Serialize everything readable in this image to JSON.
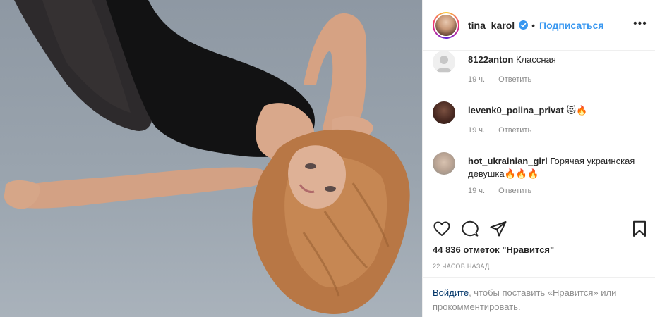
{
  "header": {
    "username": "tina_karol",
    "separator": "•",
    "follow_label": "Подписаться",
    "more_label": "•••"
  },
  "comments": [
    {
      "user": "8122anton",
      "text": "Классная",
      "time": "19 ч.",
      "reply_label": "Ответить",
      "avatar": "default-avatar"
    },
    {
      "user": "levenk0_polina_privat",
      "text": "😻🔥",
      "time": "19 ч.",
      "reply_label": "Ответить",
      "avatar": "photo"
    },
    {
      "user": "hot_ukrainian_girl",
      "text": "Горячая украинская девушка🔥🔥🔥",
      "time": "19 ч.",
      "reply_label": "Ответить",
      "avatar": "photo"
    }
  ],
  "actions": {
    "like_icon": "heart-icon",
    "comment_icon": "comment-icon",
    "share_icon": "paper-plane-icon",
    "save_icon": "bookmark-icon"
  },
  "likes_text": "44 836 отметок \"Нравится\"",
  "time_ago": "22 ЧАСОВ НАЗАД",
  "login_prompt": {
    "link": "Войдите",
    "text": ", чтобы поставить «Нравится» или прокомментировать."
  },
  "colors": {
    "link_blue": "#3897f0",
    "dark_link": "#003569",
    "muted": "#8e8e8e",
    "border": "#efefef"
  }
}
